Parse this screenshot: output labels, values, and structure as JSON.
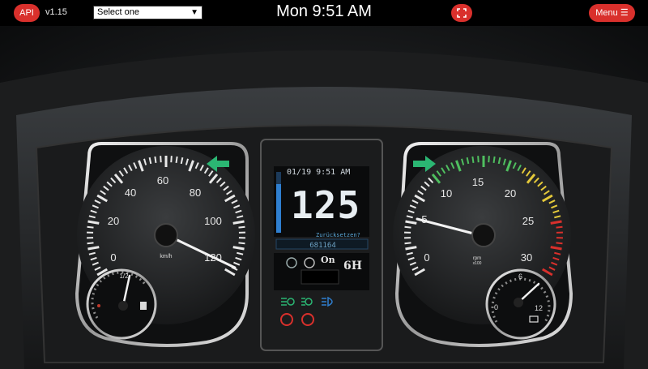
{
  "topbar": {
    "api_label": "API",
    "version": "v1.15",
    "select_value": "Select one",
    "clock": "Mon 9:51 AM",
    "menu_label": "Menu"
  },
  "speedometer": {
    "ticks": [
      "0",
      "20",
      "40",
      "60",
      "80",
      "100",
      "120"
    ],
    "unit": "km/h"
  },
  "fuel_gauge": {
    "mid_label": "1/2",
    "level": 0.6
  },
  "tachometer": {
    "ticks": [
      "0",
      "5",
      "10",
      "15",
      "20",
      "25",
      "30"
    ],
    "unit": "rpm",
    "unit_sub": "x100"
  },
  "temp_gauge": {
    "ticks": [
      "0",
      "6",
      "12"
    ]
  },
  "lcd": {
    "datetime": "01/19 9:51 AM",
    "speed": "125",
    "message": "Zurückset­zen?",
    "odometer": "681164",
    "cruise_state": "On",
    "gear": "6H"
  },
  "colors": {
    "accent_red": "#d9302c",
    "indicator_green": "#2bb673",
    "lcd_blue": "#2f7fd0"
  }
}
